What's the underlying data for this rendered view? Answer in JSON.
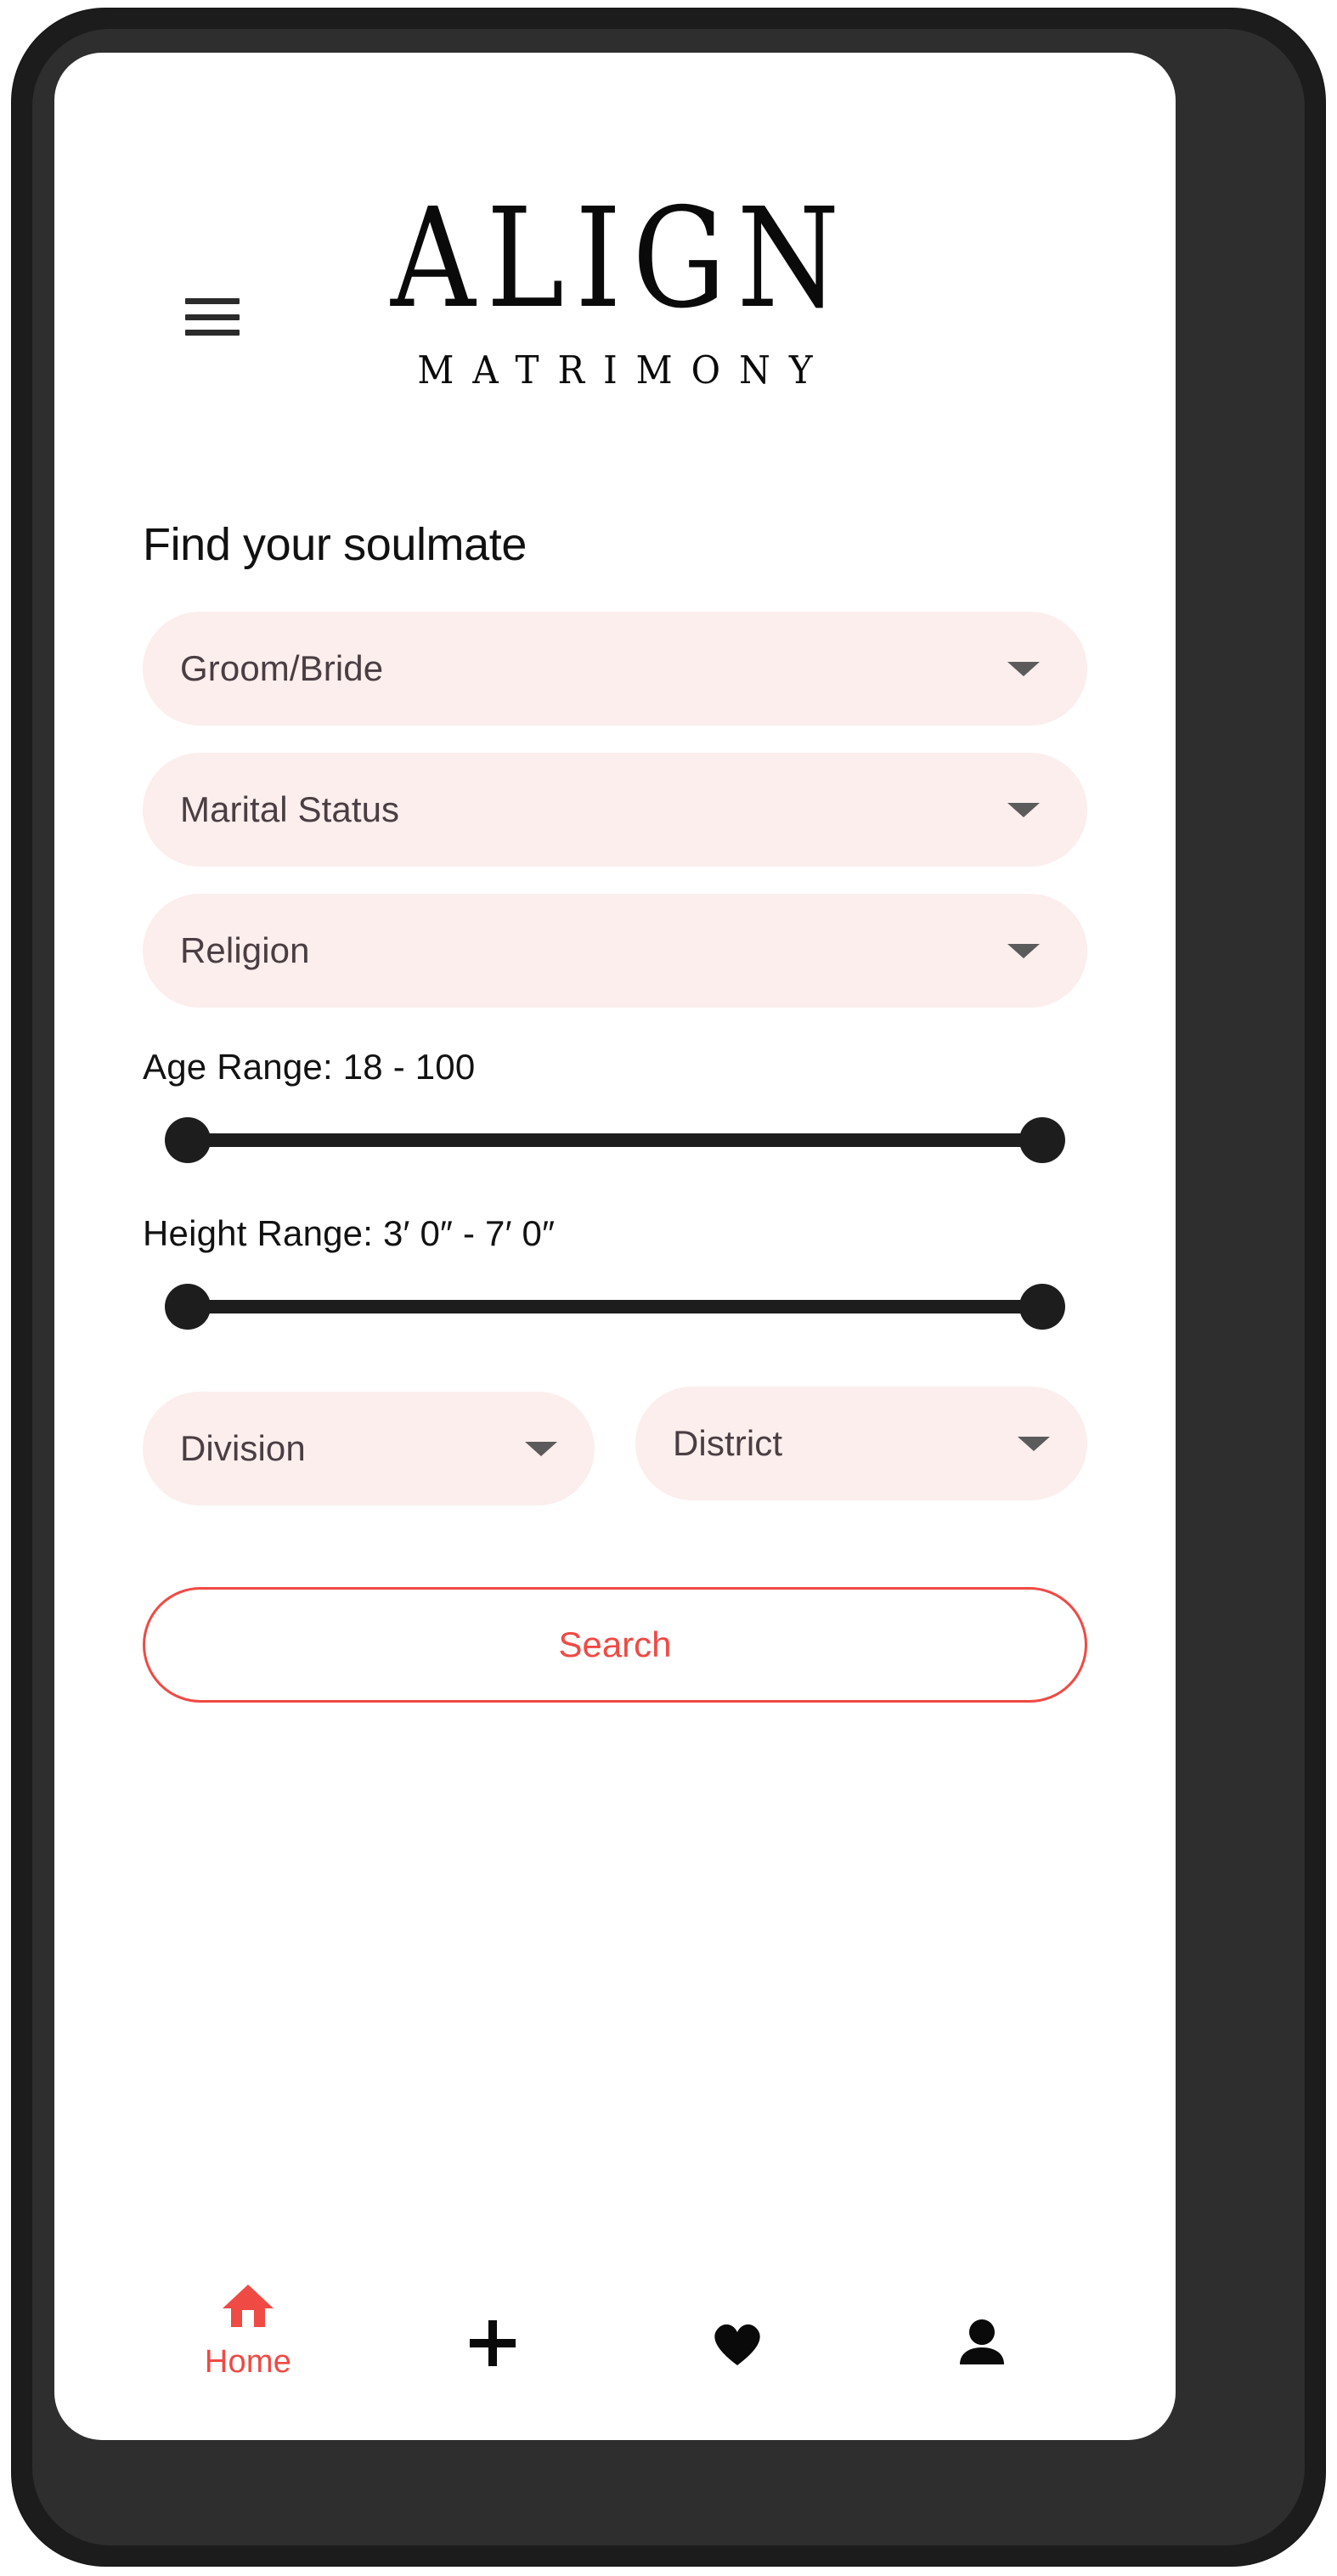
{
  "brand": {
    "wordmark": "ALIGN",
    "subtitle": "MATRIMONY",
    "heart_icon": "heart-doodle-icon",
    "heart_color": "#ef4a44"
  },
  "header": {
    "menu_icon": "hamburger-menu-icon"
  },
  "main": {
    "title": "Find your soulmate",
    "selects": [
      {
        "label": "Groom/Bride",
        "caret_icon": "caret-down-icon"
      },
      {
        "label": "Marital Status",
        "caret_icon": "caret-down-icon"
      },
      {
        "label": "Religion",
        "caret_icon": "caret-down-icon"
      }
    ],
    "age_range": {
      "label": "Age Range: 18 - 100",
      "min": 18,
      "max": 100,
      "low": 18,
      "high": 100
    },
    "height_range": {
      "label": "Height Range: 3′ 0″ - 7′ 0″",
      "min": "3′ 0″",
      "max": "7′ 0″",
      "low": "3′ 0″",
      "high": "7′ 0″"
    },
    "location": [
      {
        "label": "Division",
        "caret_icon": "caret-down-icon"
      },
      {
        "label": "District",
        "caret_icon": "caret-down-icon"
      }
    ],
    "search_button": "Search"
  },
  "bottom_nav": [
    {
      "label": "Home",
      "icon": "home-icon",
      "active": true
    },
    {
      "label": "",
      "icon": "plus-icon",
      "active": false
    },
    {
      "label": "",
      "icon": "heart-icon",
      "active": false
    },
    {
      "label": "",
      "icon": "person-icon",
      "active": false
    }
  ],
  "colors": {
    "accent": "#ef4a44",
    "pill_bg": "#fbeeed",
    "pill_text": "#4b3e42",
    "slider": "#1d1d1d",
    "bezel_outer": "#1c1c1c",
    "bezel_inner": "#2e2e2e"
  }
}
